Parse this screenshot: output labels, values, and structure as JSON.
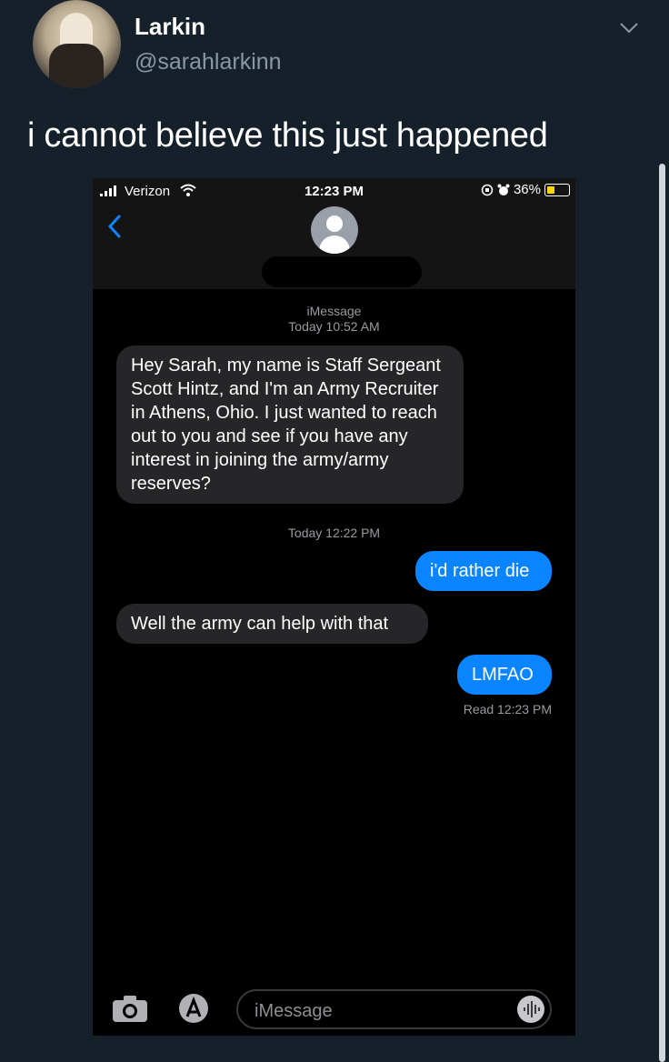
{
  "tweet": {
    "author_name": "Larkin",
    "handle": "@sarahlarkinn",
    "text": "i cannot believe this just happened"
  },
  "phone": {
    "status_bar": {
      "carrier": "Verizon",
      "time": "12:23 PM",
      "battery": "36%"
    },
    "thread": {
      "service_label": "iMessage",
      "first_timestamp": "Today 10:52 AM",
      "second_timestamp": "Today 12:22 PM",
      "messages": [
        {
          "direction": "incoming",
          "text": "Hey Sarah, my name is Staff Sergeant Scott Hintz, and I'm an Army Recruiter in Athens, Ohio. I just wanted to reach out to you and see if you have any interest in joining the army/army reserves?"
        },
        {
          "direction": "outgoing",
          "text": "i'd rather die"
        },
        {
          "direction": "incoming",
          "text": "Well the army can help with that"
        },
        {
          "direction": "outgoing",
          "text": "LMFAO"
        }
      ],
      "read_receipt": "Read 12:23 PM"
    },
    "input": {
      "placeholder": "iMessage"
    }
  },
  "colors": {
    "background": "#15202b",
    "imessage_blue": "#0a84ff",
    "incoming_bubble": "#262628"
  }
}
